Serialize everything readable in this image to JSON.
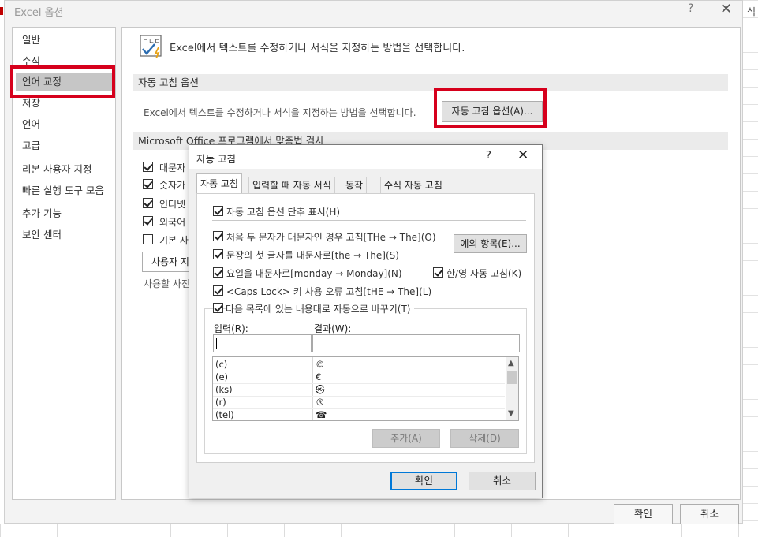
{
  "window": {
    "title": "Excel 옵션",
    "help_glyph": "?",
    "close_glyph": "✕"
  },
  "background": {
    "right_text": "식"
  },
  "sidebar": {
    "items": [
      {
        "label": "일반"
      },
      {
        "label": "수식"
      },
      {
        "label": "언어 교정",
        "active": true
      },
      {
        "label": "저장"
      },
      {
        "label": "언어"
      },
      {
        "label": "고급"
      },
      {
        "label": "리본 사용자 지정"
      },
      {
        "label": "빠른 실행 도구 모음"
      },
      {
        "label": "추가 기능"
      },
      {
        "label": "보안 센터"
      }
    ]
  },
  "main": {
    "intro": "Excel에서 텍스트를 수정하거나 서식을 지정하는 방법을 선택합니다.",
    "icon": "abc-check-icon",
    "autocorrect_section": {
      "header": "자동 고침 옵션",
      "text": "Excel에서 텍스트를 수정하거나 서식을 지정하는 방법을 선택합니다.",
      "button": "자동 고침 옵션(A)..."
    },
    "spelling_section": {
      "header": "Microsoft Office 프로그램에서 맞춤법 검사",
      "checkboxes": [
        {
          "label": "대문자",
          "checked": true
        },
        {
          "label": "숫자가",
          "checked": true
        },
        {
          "label": "인터넷",
          "checked": true
        },
        {
          "label": "외국어",
          "checked": true
        },
        {
          "label": "기본 사",
          "checked": false
        }
      ],
      "user_dict_button": "사용자 지",
      "dict_note": "사용할 사전"
    },
    "ok": "확인",
    "cancel": "취소"
  },
  "dialog": {
    "title": "자동 고침",
    "help_glyph": "?",
    "close_glyph": "✕",
    "tabs": [
      "자동 고침",
      "입력할 때 자동 서식",
      "동작",
      "수식 자동 고침"
    ],
    "show_buttons": {
      "label": "자동 고침 옵션 단추 표시(H)",
      "checked": true
    },
    "options": [
      {
        "label": "처음 두 문자가 대문자인 경우 고침[THe → The](O)",
        "checked": true
      },
      {
        "label": "문장의 첫 글자를 대문자로[the → The](S)",
        "checked": true
      },
      {
        "label": "요일을 대문자로[monday → Monday](N)",
        "checked": true
      },
      {
        "label": "<Caps Lock> 키 사용 오류 고침[tHE → The](L)",
        "checked": true
      }
    ],
    "korean_english": {
      "label": "한/영 자동 고침(K)",
      "checked": true
    },
    "exceptions_button": "예외 항목(E)...",
    "replace_group": {
      "label": "다음 목록에 있는 내용대로 자동으로 바꾸기(T)",
      "checked": true
    },
    "input_label": "입력(R):",
    "result_label": "결과(W):",
    "input_value": "",
    "result_value": "",
    "list": [
      {
        "input": "(c)",
        "result": "©"
      },
      {
        "input": "(e)",
        "result": "€"
      },
      {
        "input": "(ks)",
        "result": "㉿"
      },
      {
        "input": "(r)",
        "result": "®"
      },
      {
        "input": "(tel)",
        "result": "☎"
      }
    ],
    "add_button": "추가(A)",
    "delete_button": "삭제(D)",
    "ok": "확인",
    "cancel": "취소"
  }
}
